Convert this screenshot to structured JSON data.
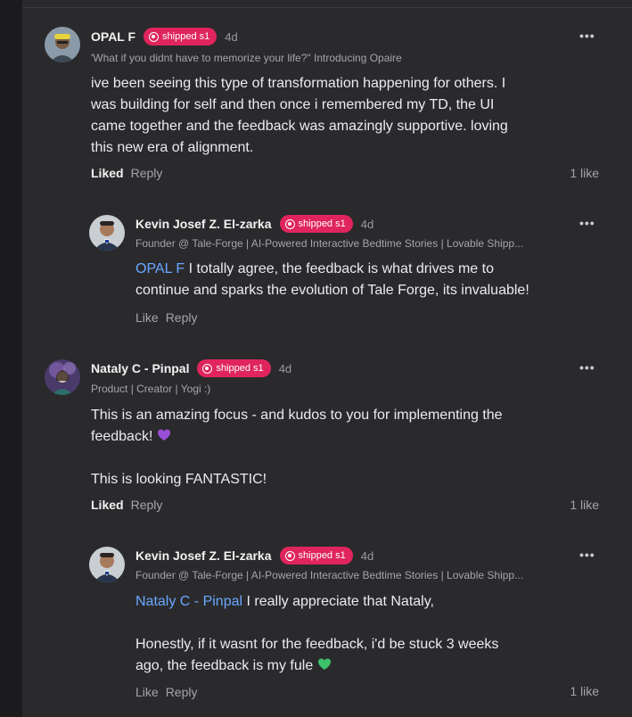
{
  "thread": [
    {
      "author": "OPAL F",
      "badge": "shipped s1",
      "time": "4d",
      "tagline": "'What if you didnt have to memorize your life?\" Introducing Opaire",
      "body_lines": [
        "ive been seeing this type of transformation happening for others. I",
        "was building for self and then once i remembered my TD, the UI",
        "came together and the feedback was amazingly supportive. loving",
        "this new era of alignment."
      ],
      "like_label": "Liked",
      "reply_label": "Reply",
      "like_count": "1 like",
      "more_label": "•••"
    },
    {
      "author": "Kevin Josef Z. El-zarka",
      "badge": "shipped s1",
      "time": "4d",
      "tagline": "Founder @ Tale-Forge | AI-Powered Interactive Bedtime Stories | Lovable Shipp...",
      "mention": "OPAL F",
      "body_line1_rest": " I totally agree, the feedback is what drives me to",
      "body_line2": "continue and sparks the evolution of Tale Forge, its invaluable!",
      "like_label": "Like",
      "reply_label": "Reply",
      "more_label": "•••"
    },
    {
      "author": "Nataly C - Pinpal",
      "badge": "shipped s1",
      "time": "4d",
      "tagline": "Product | Creator | Yogi :)",
      "body_line1": "This is an amazing focus - and kudos to you for implementing the",
      "body_line2": "feedback!",
      "body_line3": "This is looking FANTASTIC!",
      "like_label": "Liked",
      "reply_label": "Reply",
      "like_count": "1 like",
      "more_label": "•••"
    },
    {
      "author": "Kevin Josef Z. El-zarka",
      "badge": "shipped s1",
      "time": "4d",
      "tagline": "Founder @ Tale-Forge | AI-Powered Interactive Bedtime Stories | Lovable Shipp...",
      "mention": "Nataly C - Pinpal",
      "body_line1_rest": " I really appreciate that Nataly,",
      "body_line2": "Honestly, if it wasnt for the feedback, i'd be stuck 3 weeks",
      "body_line3": "ago, the feedback is my fule",
      "like_label": "Like",
      "reply_label": "Reply",
      "like_count": "1 like",
      "more_label": "•••"
    }
  ],
  "icons": {
    "badge": "shipped-badge-icon",
    "heart": "purple-heart-emoji",
    "green_heart": "green-heart-emoji"
  },
  "colors": {
    "background": "#2a2a2d",
    "badge": "#e0255c",
    "mention": "#6aa8ff"
  }
}
